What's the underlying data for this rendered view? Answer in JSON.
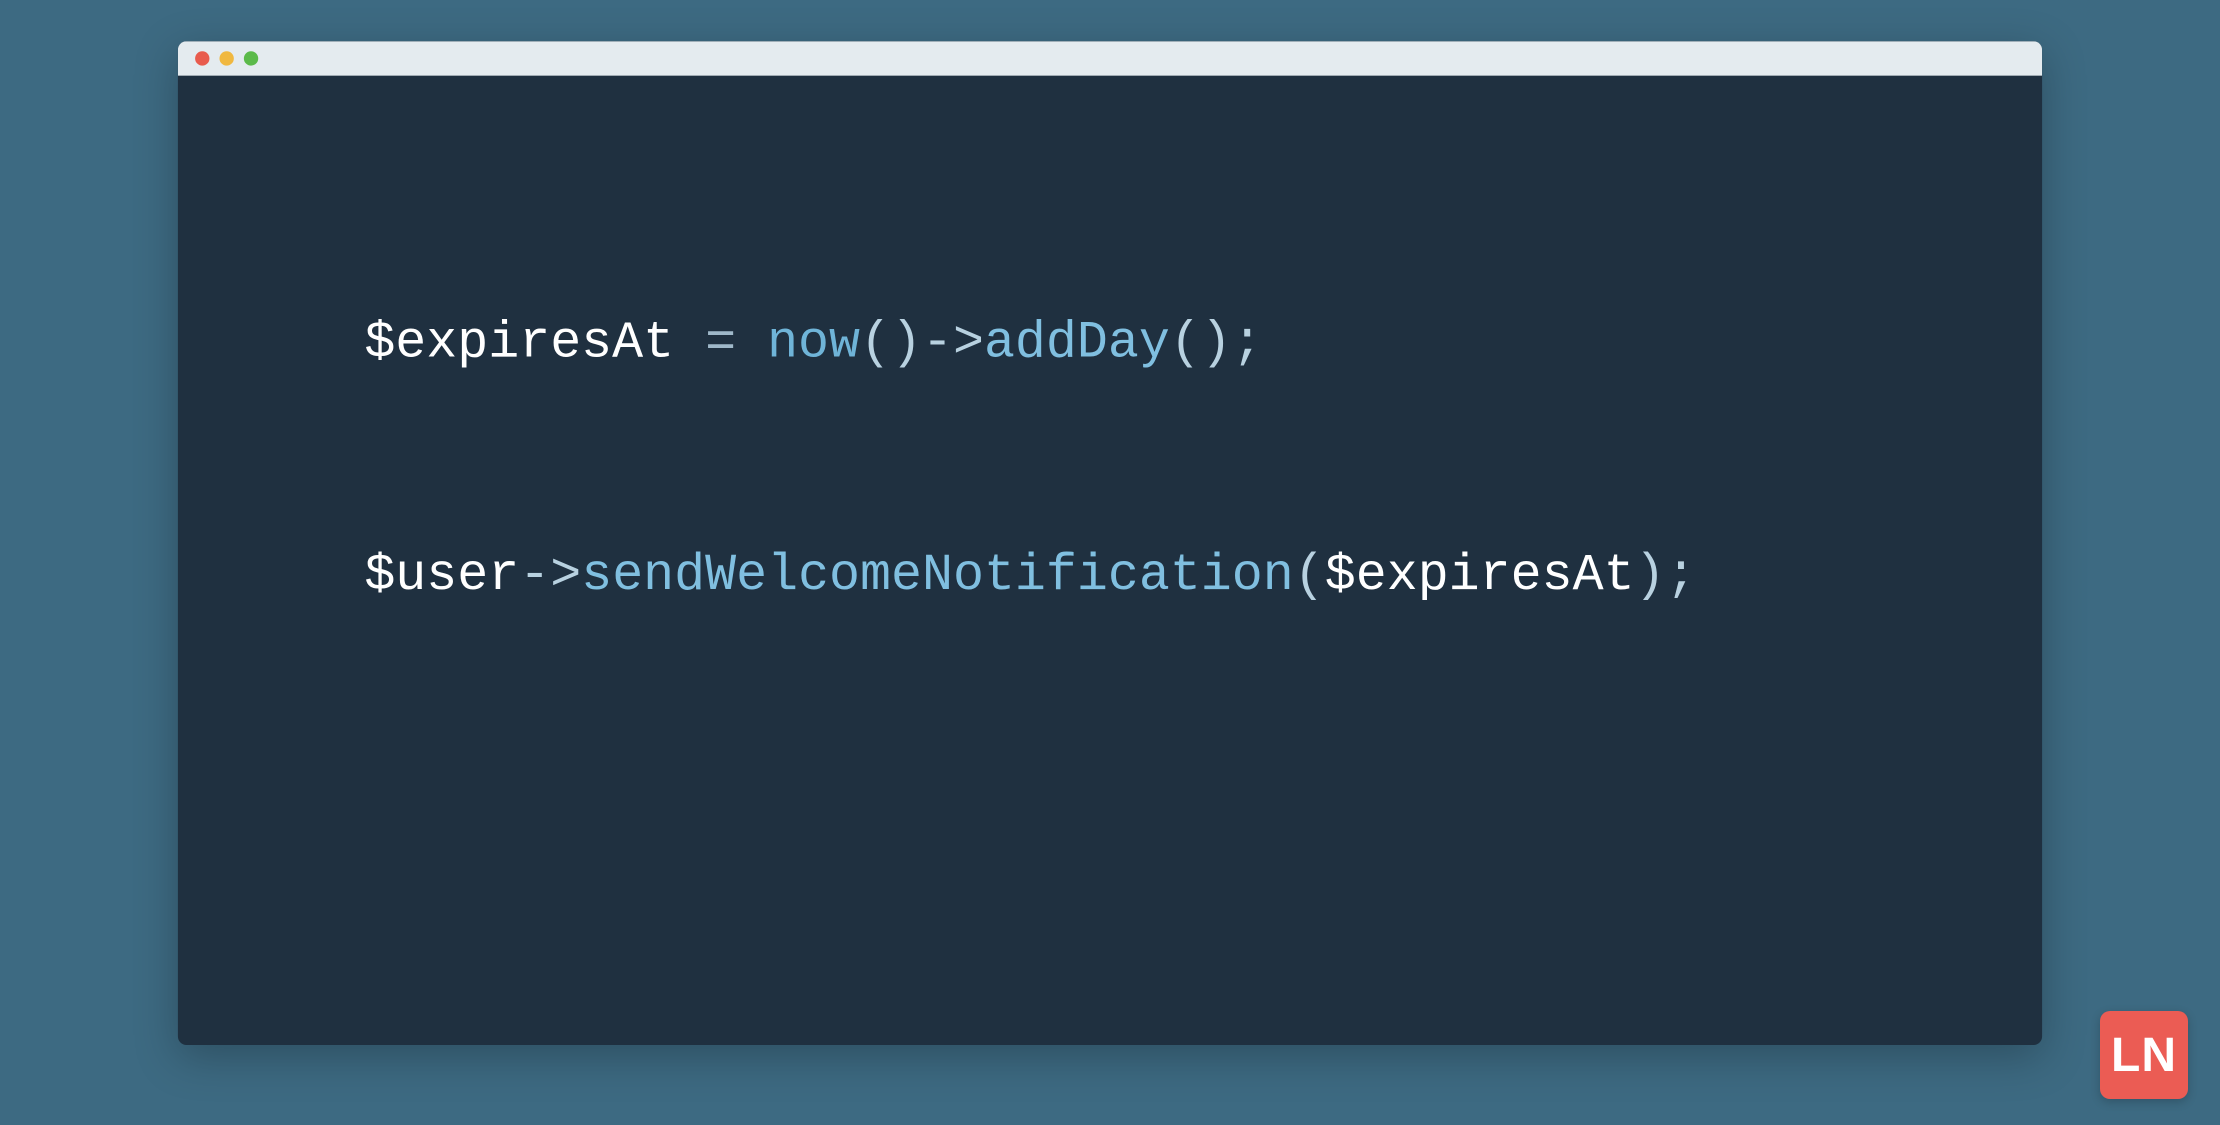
{
  "colors": {
    "page_bg": "#3d6a82",
    "window_bg": "#1f3040",
    "titlebar_bg": "#e4ebef",
    "traffic_close": "#e85b4d",
    "traffic_minimize": "#f0b840",
    "traffic_maximize": "#5bba4a",
    "logo_bg": "#eb5c54"
  },
  "code": {
    "line1": {
      "t0": "$",
      "t1": "expiresAt",
      "t2": " = ",
      "t3": "now",
      "t4": "()->",
      "t5": "addDay",
      "t6": "();"
    },
    "line2": {
      "t0": "$",
      "t1": "user",
      "t2": "->",
      "t3": "sendWelcomeNotification",
      "t4": "(",
      "t5": "$",
      "t6": "expiresAt",
      "t7": ");"
    }
  },
  "logo": {
    "text": "LN"
  }
}
